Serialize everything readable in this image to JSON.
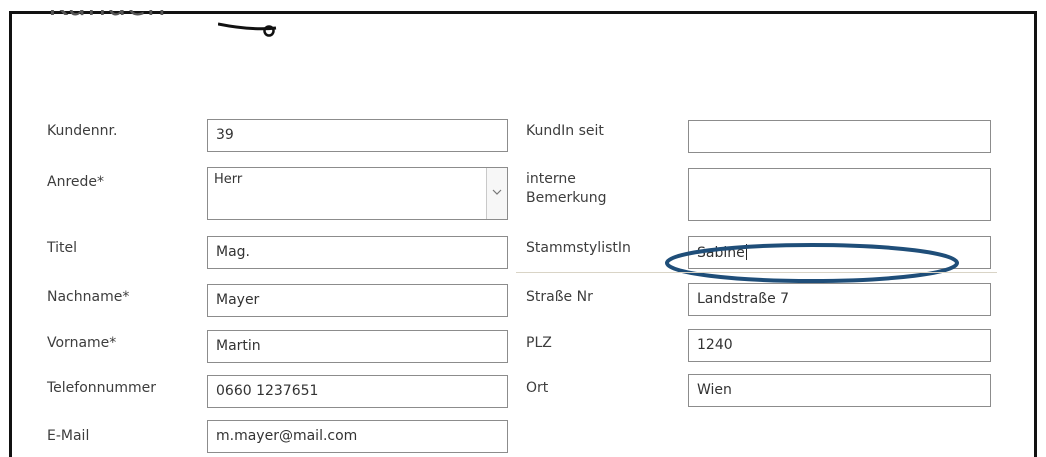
{
  "header": {
    "title_fragment": "Kunden"
  },
  "form": {
    "left": [
      {
        "label": "Kundennr.",
        "value": "39"
      },
      {
        "label": "Anrede*",
        "value": "Herr"
      },
      {
        "label": "Titel",
        "value": "Mag."
      },
      {
        "label": "Nachname*",
        "value": "Mayer"
      },
      {
        "label": "Vorname*",
        "value": "Martin"
      },
      {
        "label": "Telefonnummer",
        "value": "0660 1237651"
      },
      {
        "label": "E-Mail",
        "value": "m.mayer@mail.com"
      }
    ],
    "right": [
      {
        "label": "KundIn seit",
        "value": ""
      },
      {
        "label_line1": "interne",
        "label_line2": "Bemerkung",
        "value": ""
      },
      {
        "label": "StammstylistIn",
        "value": "Sabine"
      },
      {
        "label": "Straße Nr",
        "value": "Landstraße 7"
      },
      {
        "label": "PLZ",
        "value": "1240"
      },
      {
        "label": "Ort",
        "value": "Wien"
      }
    ]
  },
  "annotation": {
    "color": "#1f4e79",
    "target": "StammstylistIn"
  },
  "icons": {
    "select_arrow": "chevron-down-icon",
    "hook": "hook-icon"
  }
}
